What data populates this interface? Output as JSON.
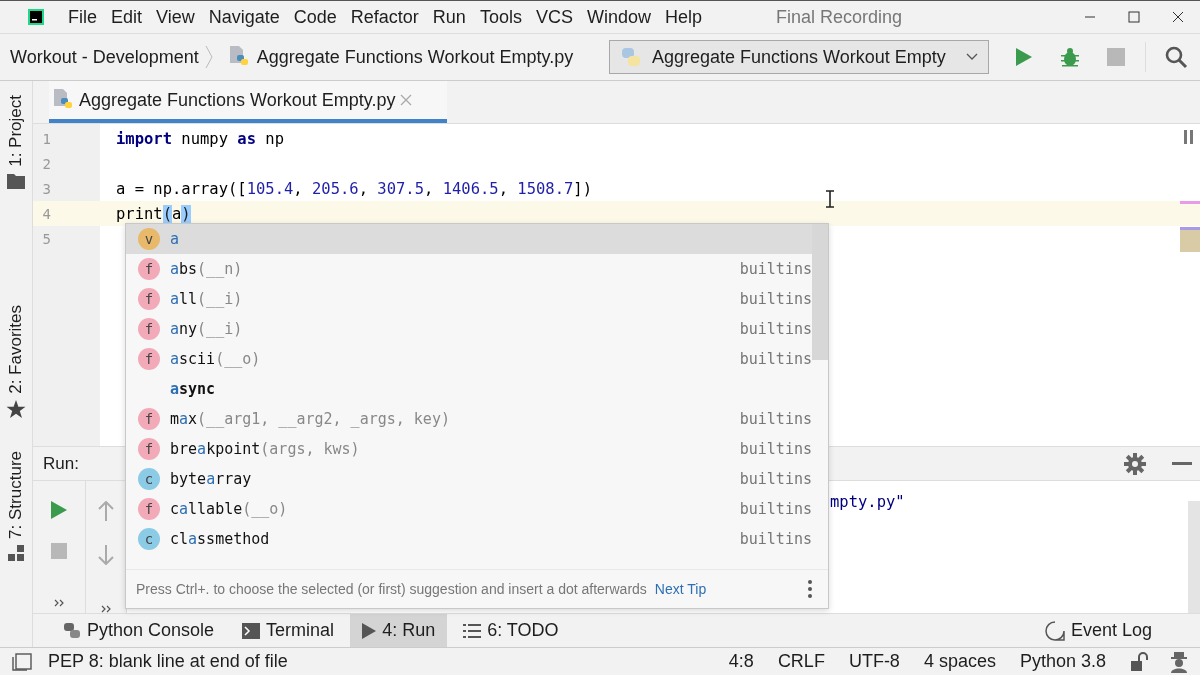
{
  "window": {
    "title": "Final Recording"
  },
  "menu": [
    {
      "label": "File"
    },
    {
      "label": "Edit"
    },
    {
      "label": "View"
    },
    {
      "label": "Navigate"
    },
    {
      "label": "Code"
    },
    {
      "label": "Refactor"
    },
    {
      "label": "Run"
    },
    {
      "label": "Tools"
    },
    {
      "label": "VCS"
    },
    {
      "label": "Window"
    },
    {
      "label": "Help"
    }
  ],
  "breadcrumb": {
    "project": "Workout - Development",
    "file": "Aggregate Functions Workout Empty.py"
  },
  "run_config": {
    "label": "Aggregate Functions Workout Empty"
  },
  "side_tabs": [
    {
      "label": "1: Project",
      "kind": "project"
    },
    {
      "label": "2: Favorites",
      "kind": "favorites"
    },
    {
      "label": "7: Structure",
      "kind": "structure"
    }
  ],
  "editor_tabs": [
    {
      "label": "Aggregate Functions Workout Empty.py",
      "selected": true
    }
  ],
  "code_lines": [
    {
      "number": "1",
      "current": false,
      "tokens": [
        {
          "text": "import",
          "kind": "keyword"
        },
        {
          "text": " numpy ",
          "kind": "plain"
        },
        {
          "text": "as",
          "kind": "keyword"
        },
        {
          "text": " np",
          "kind": "plain"
        }
      ]
    },
    {
      "number": "2",
      "current": false
    },
    {
      "number": "3",
      "current": false,
      "tokens": [
        {
          "text": "a = np.array([",
          "kind": "plain"
        },
        {
          "text": "105.4",
          "kind": "number"
        },
        {
          "text": ", ",
          "kind": "plain"
        },
        {
          "text": "205.6",
          "kind": "number"
        },
        {
          "text": ", ",
          "kind": "plain"
        },
        {
          "text": "307.5",
          "kind": "number"
        },
        {
          "text": ", ",
          "kind": "plain"
        },
        {
          "text": "1406.5",
          "kind": "number"
        },
        {
          "text": ", ",
          "kind": "plain"
        },
        {
          "text": "1508.7",
          "kind": "number"
        },
        {
          "text": "])",
          "kind": "plain"
        }
      ]
    },
    {
      "number": "4",
      "current": true,
      "tokens": [
        {
          "text": "print",
          "kind": "plain"
        },
        {
          "text": "(",
          "kind": "brace"
        },
        {
          "text": "a",
          "kind": "plain"
        },
        {
          "text": ")",
          "kind": "brace"
        }
      ]
    },
    {
      "number": "5",
      "current": false
    }
  ],
  "completion": {
    "items": [
      {
        "kind": "variable",
        "badge": "v",
        "selected": true,
        "name_parts": [
          {
            "text": "a",
            "matched": true
          }
        ]
      },
      {
        "kind": "function",
        "badge": "f",
        "selected": false,
        "name_parts": [
          {
            "text": "a",
            "matched": true
          },
          {
            "text": "bs",
            "matched": false
          }
        ],
        "params": "(__n)",
        "source": "builtins"
      },
      {
        "kind": "function",
        "badge": "f",
        "selected": false,
        "name_parts": [
          {
            "text": "a",
            "matched": true
          },
          {
            "text": "ll",
            "matched": false
          }
        ],
        "params": "(__i)",
        "source": "builtins"
      },
      {
        "kind": "function",
        "badge": "f",
        "selected": false,
        "name_parts": [
          {
            "text": "a",
            "matched": true
          },
          {
            "text": "ny",
            "matched": false
          }
        ],
        "params": "(__i)",
        "source": "builtins"
      },
      {
        "kind": "function",
        "badge": "f",
        "selected": false,
        "name_parts": [
          {
            "text": "a",
            "matched": true
          },
          {
            "text": "scii",
            "matched": false
          }
        ],
        "params": "(__o)",
        "source": "builtins"
      },
      {
        "kind": "keyword",
        "selected": false,
        "name_parts": [
          {
            "text": "a",
            "matched": true
          },
          {
            "text": "sync",
            "matched": false
          }
        ]
      },
      {
        "kind": "function",
        "badge": "f",
        "selected": false,
        "name_parts": [
          {
            "text": "m",
            "matched": false
          },
          {
            "text": "a",
            "matched": true
          },
          {
            "text": "x",
            "matched": false
          }
        ],
        "params": "(__arg1, __arg2, _args, key)",
        "source": "builtins"
      },
      {
        "kind": "function",
        "badge": "f",
        "selected": false,
        "name_parts": [
          {
            "text": "bre",
            "matched": false
          },
          {
            "text": "a",
            "matched": true
          },
          {
            "text": "kpoint",
            "matched": false
          }
        ],
        "params": "(args, kws)",
        "source": "builtins"
      },
      {
        "kind": "class",
        "badge": "c",
        "selected": false,
        "name_parts": [
          {
            "text": "byte",
            "matched": false
          },
          {
            "text": "a",
            "matched": true
          },
          {
            "text": "rray",
            "matched": false
          }
        ],
        "source": "builtins"
      },
      {
        "kind": "function",
        "badge": "f",
        "selected": false,
        "name_parts": [
          {
            "text": "c",
            "matched": false
          },
          {
            "text": "a",
            "matched": true
          },
          {
            "text": "llable",
            "matched": false
          }
        ],
        "params": "(__o)",
        "source": "builtins"
      },
      {
        "kind": "class",
        "badge": "c",
        "selected": false,
        "name_parts": [
          {
            "text": "cl",
            "matched": false
          },
          {
            "text": "a",
            "matched": true
          },
          {
            "text": "ssmethod",
            "matched": false
          }
        ],
        "source": "builtins"
      }
    ],
    "hint": "Press Ctrl+. to choose the selected (or first) suggestion and insert a dot afterwards",
    "next_tip": "Next Tip"
  },
  "run_panel": {
    "label": "Run:",
    "output": "mpty.py\""
  },
  "tool_tabs": [
    {
      "label": "Python Console",
      "kind": "python",
      "selected": false
    },
    {
      "label": "Terminal",
      "kind": "terminal",
      "selected": false
    },
    {
      "label": "4: Run",
      "kind": "run",
      "selected": true
    },
    {
      "label": "6: TODO",
      "kind": "todo",
      "selected": false
    }
  ],
  "event_log": "Event Log",
  "status_bar": {
    "message": "PEP 8: blank line at end of file",
    "items": [
      "4:8",
      "CRLF",
      "UTF-8",
      "4 spaces",
      "Python 3.8"
    ]
  }
}
